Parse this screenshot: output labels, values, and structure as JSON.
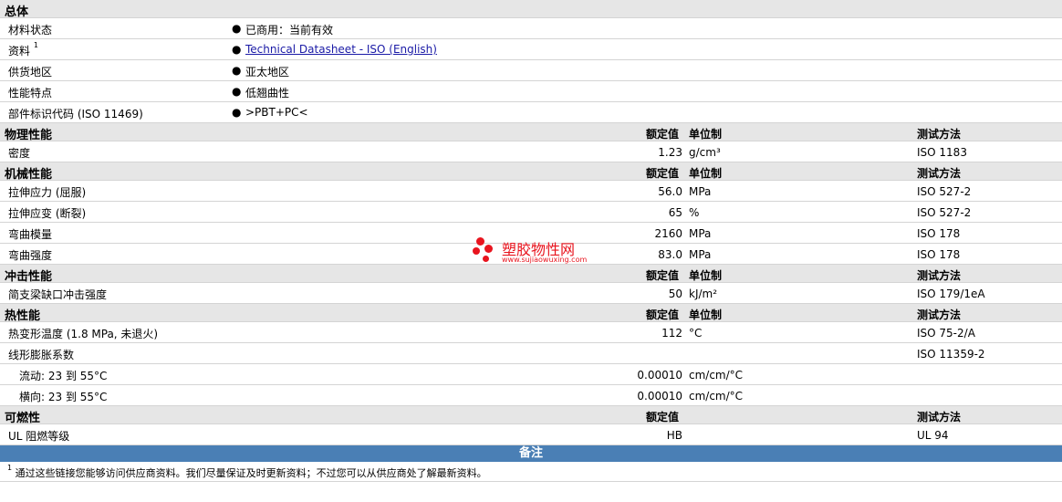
{
  "general": {
    "title": "总体",
    "rows": [
      {
        "label": "材料状态",
        "value": "已商用：当前有效",
        "link": false
      },
      {
        "label": "资料",
        "sup": "1",
        "value": "Technical Datasheet - ISO (English)",
        "link": true
      },
      {
        "label": "供货地区",
        "value": "亚太地区",
        "link": false
      },
      {
        "label": "性能特点",
        "value": "低翘曲性",
        "link": false
      },
      {
        "label": "部件标识代码 (ISO 11469)",
        "value": ">PBT+PC<",
        "link": false
      }
    ],
    "bullet": "●"
  },
  "columns": {
    "nominal": "额定值",
    "unit": "单位制",
    "method": "测试方法"
  },
  "physical": {
    "title": "物理性能",
    "rows": [
      {
        "label": "密度",
        "value": "1.23",
        "unit": "g/cm³",
        "method": "ISO 1183"
      }
    ]
  },
  "mechanical": {
    "title": "机械性能",
    "rows": [
      {
        "label": "拉伸应力 (屈服)",
        "value": "56.0",
        "unit": "MPa",
        "method": "ISO 527-2"
      },
      {
        "label": "拉伸应变 (断裂)",
        "value": "65",
        "unit": "%",
        "method": "ISO 527-2"
      },
      {
        "label": "弯曲模量",
        "value": "2160",
        "unit": "MPa",
        "method": "ISO 178"
      },
      {
        "label": "弯曲强度",
        "value": "83.0",
        "unit": "MPa",
        "method": "ISO 178"
      }
    ]
  },
  "impact": {
    "title": "冲击性能",
    "rows": [
      {
        "label": "简支梁缺口冲击强度",
        "value": "50",
        "unit": "kJ/m²",
        "method": "ISO 179/1eA"
      }
    ]
  },
  "thermal": {
    "title": "热性能",
    "rows": [
      {
        "label": "热变形温度 (1.8 MPa, 未退火)",
        "value": "112",
        "unit": "°C",
        "method": "ISO 75-2/A"
      },
      {
        "label": "线形膨胀系数",
        "value": "",
        "unit": "",
        "method": "ISO 11359-2"
      },
      {
        "label": "流动: 23 到  55°C",
        "value": "0.00010",
        "unit": "cm/cm/°C",
        "method": ""
      },
      {
        "label": "横向: 23 到  55°C",
        "value": "0.00010",
        "unit": "cm/cm/°C",
        "method": ""
      }
    ]
  },
  "flammability": {
    "title": "可燃性",
    "rows": [
      {
        "label": "UL 阻燃等级",
        "value": "HB",
        "unit": "",
        "method": "UL 94"
      }
    ]
  },
  "notes": {
    "title": "备注",
    "sup": "1",
    "text": "通过这些链接您能够访问供应商资料。我们尽量保证及时更新资料；不过您可以从供应商处了解最新资料。"
  },
  "watermark": {
    "name": "塑胶物性网",
    "url": "www.sujiaowuxing.com",
    "color": "#e8141e"
  }
}
